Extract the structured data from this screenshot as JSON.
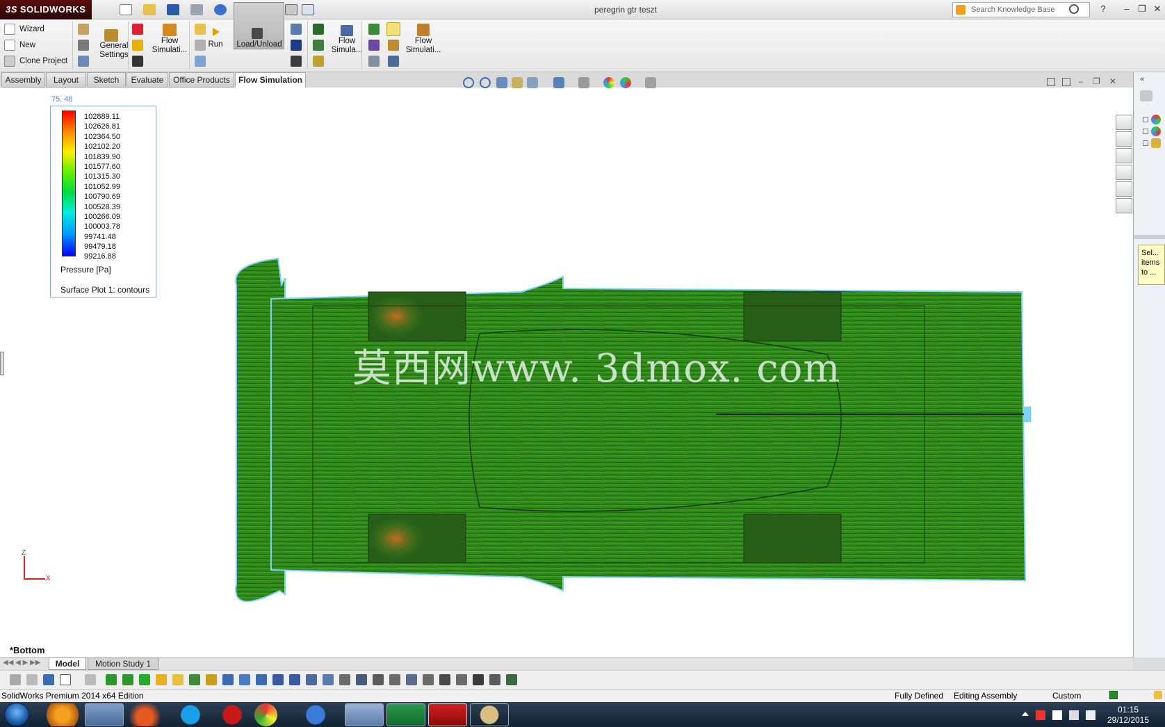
{
  "app": {
    "logo_text": "SOLIDWORKS",
    "logo_ds": "3S",
    "document_title": "peregrin gtr teszt",
    "search_placeholder": "Search Knowledge Base"
  },
  "ribbon": {
    "wizard": "Wizard",
    "new": "New",
    "clone_project": "Clone Project",
    "general_settings_l1": "General",
    "general_settings_l2": "Settings",
    "flow_sim_1_l1": "Flow",
    "flow_sim_1_l2": "Simulati...",
    "run": "Run",
    "load_unload": "Load/Unload",
    "flow_sim_2_l1": "Flow",
    "flow_sim_2_l2": "Simula...",
    "flow_sim_3_l1": "Flow",
    "flow_sim_3_l2": "Simulati..."
  },
  "tabs": [
    "Assembly",
    "Layout",
    "Sketch",
    "Evaluate",
    "Office Products",
    "Flow Simulation"
  ],
  "legend": {
    "coord": "75, 48",
    "values": [
      "102889.11",
      "102626.81",
      "102364.50",
      "102102.20",
      "101839.90",
      "101577.60",
      "101315.30",
      "101052.99",
      "100790.69",
      "100528.39",
      "100266.09",
      "100003.78",
      "99741.48",
      "99479.18",
      "99216.88"
    ],
    "quantity": "Pressure [Pa]",
    "plot_name": "Surface Plot 1: contours"
  },
  "watermark": "莫西网www. 3dmox. com",
  "view_name": "*Bottom",
  "triad": {
    "z": "Z",
    "x": "X"
  },
  "model_tabs": [
    "Model",
    "Motion Study 1"
  ],
  "tooltip": [
    "Sel...",
    "items",
    "to ..."
  ],
  "status": {
    "edition": "SolidWorks Premium 2014 x64 Edition",
    "defined": "Fully Defined",
    "mode": "Editing Assembly",
    "units": "Custom"
  },
  "clock": {
    "time": "01:15",
    "date": "29/12/2015"
  },
  "colors": {
    "brand": "#5a0f0f",
    "car_green": "#2f8a1a",
    "legend_border": "#7fa7d0"
  }
}
